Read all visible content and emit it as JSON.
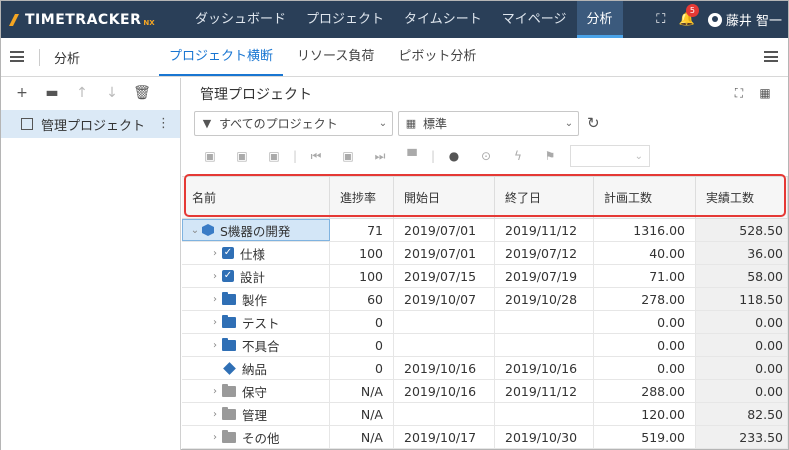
{
  "app": {
    "logo_text": "TIMETRACKER",
    "logo_suffix": "NX"
  },
  "topnav": [
    "ダッシュボード",
    "プロジェクト",
    "タイムシート",
    "マイページ",
    "分析"
  ],
  "notifications_count": "5",
  "user_name": "藤井 智一",
  "subbar": {
    "title": "分析",
    "tabs": [
      "プロジェクト横断",
      "リソース負荷",
      "ピボット分析"
    ]
  },
  "left_panel": {
    "selected_item": "管理プロジェクト"
  },
  "main": {
    "title": "管理プロジェクト",
    "filter_projects": "すべてのプロジェクト",
    "filter_view": "標準"
  },
  "grid": {
    "headers": [
      "名前",
      "進捗率",
      "開始日",
      "終了日",
      "計画工数",
      "実績工数"
    ],
    "rows": [
      {
        "name": "S機器の開発",
        "icon": "cube",
        "expanded": true,
        "progress": "71",
        "start": "2019/07/01",
        "end": "2019/11/12",
        "plan": "1316.00",
        "actual": "528.50"
      },
      {
        "name": "仕様",
        "icon": "check",
        "progress": "100",
        "start": "2019/07/01",
        "end": "2019/07/12",
        "plan": "40.00",
        "actual": "36.00"
      },
      {
        "name": "設計",
        "icon": "check",
        "progress": "100",
        "start": "2019/07/15",
        "end": "2019/07/19",
        "plan": "71.00",
        "actual": "58.00"
      },
      {
        "name": "製作",
        "icon": "folder-blue",
        "progress": "60",
        "start": "2019/10/07",
        "end": "2019/10/28",
        "plan": "278.00",
        "actual": "118.50"
      },
      {
        "name": "テスト",
        "icon": "folder-blue",
        "progress": "0",
        "start": "",
        "end": "",
        "plan": "0.00",
        "actual": "0.00"
      },
      {
        "name": "不具合",
        "icon": "folder-blue",
        "progress": "0",
        "start": "",
        "end": "",
        "plan": "0.00",
        "actual": "0.00"
      },
      {
        "name": "納品",
        "icon": "diamond",
        "progress": "0",
        "start": "2019/10/16",
        "end": "2019/10/16",
        "plan": "0.00",
        "actual": "0.00"
      },
      {
        "name": "保守",
        "icon": "folder-gray",
        "progress": "N/A",
        "start": "2019/10/16",
        "end": "2019/11/12",
        "plan": "288.00",
        "actual": "0.00"
      },
      {
        "name": "管理",
        "icon": "folder-gray",
        "progress": "N/A",
        "start": "",
        "end": "",
        "plan": "120.00",
        "actual": "82.50"
      },
      {
        "name": "その他",
        "icon": "folder-gray",
        "progress": "N/A",
        "start": "2019/10/17",
        "end": "2019/10/30",
        "plan": "519.00",
        "actual": "233.50"
      }
    ]
  },
  "colors": {
    "topbar": "#2a3f58",
    "accent": "#1976d2",
    "highlight": "#e53935"
  }
}
